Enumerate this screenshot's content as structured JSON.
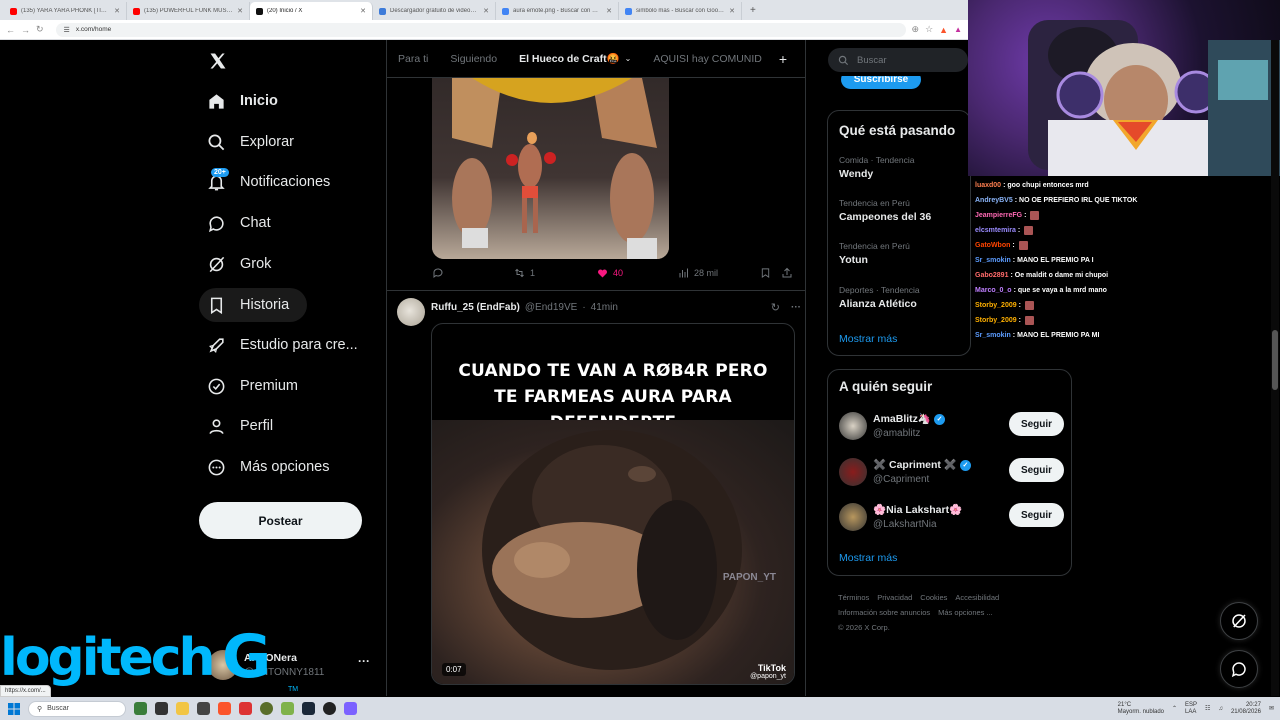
{
  "browser": {
    "tabs": [
      {
        "title": "(135) YARA YARA PHONK [TIKTOK VI...",
        "color": "#ff0000",
        "active": false
      },
      {
        "title": "(135) POWERFUL FUNK MUSIC → T...",
        "color": "#ff0000",
        "active": false
      },
      {
        "title": "(20) Inicio / X",
        "color": "#111111",
        "active": true
      },
      {
        "title": "Descargador gratuito de videos de T...",
        "color": "#3d7bd9",
        "active": false
      },
      {
        "title": "aura emote.png - Buscar con Google",
        "color": "#4285f4",
        "active": false
      },
      {
        "title": "simbolo mas - Buscar con Google",
        "color": "#4285f4",
        "active": false
      }
    ],
    "new_tab_glyph": "+",
    "url": "x.com/home",
    "status_url": "https://x.com/..."
  },
  "sidebar": {
    "logo": "X",
    "items": [
      {
        "label": "Inicio",
        "icon": "home-icon"
      },
      {
        "label": "Explorar",
        "icon": "search-icon"
      },
      {
        "label": "Notificaciones",
        "icon": "bell-icon",
        "badge": "20+"
      },
      {
        "label": "Chat",
        "icon": "chat-bubble-icon"
      },
      {
        "label": "Grok",
        "icon": "grok-icon"
      },
      {
        "label": "Historia",
        "icon": "bookmark-icon"
      },
      {
        "label": "Estudio para cre...",
        "icon": "rocket-icon"
      },
      {
        "label": "Premium",
        "icon": "verified-badge-icon"
      },
      {
        "label": "Perfil",
        "icon": "person-icon"
      },
      {
        "label": "Más opciones",
        "icon": "more-circle-icon"
      }
    ],
    "post_label": "Postear",
    "account": {
      "name": "ANTONera",
      "handle": "@ANTONNY1811",
      "more": "···"
    }
  },
  "overlay": {
    "logitech": "logitech",
    "g": "G",
    "tm": "TM"
  },
  "feed": {
    "tabs": [
      {
        "label": "Para ti",
        "active": false
      },
      {
        "label": "Siguiendo",
        "active": false
      },
      {
        "label": "El Hueco de Craft🤬",
        "active": true
      },
      {
        "label": "AQUISI hay COMUNID",
        "active": false
      }
    ],
    "add_tab": "+",
    "post1": {
      "replies": "",
      "reposts": "1",
      "likes": "40",
      "views": "28 mil",
      "like_color": "#f91880"
    },
    "post2": {
      "author": "Ruffu_25 (EndFab)",
      "handle": "@End19VE",
      "time": "41min",
      "meme_line1": "CUANDO TE VAN A RØB4R PERO",
      "meme_line2": "TE FARMEAS AURA PARA DEFENDERTE",
      "watermark": "PAPON_YT",
      "duration": "0:07",
      "tiktok": "TikTok",
      "tiktok_user": "@papon_yt"
    }
  },
  "right": {
    "search_placeholder": "Buscar",
    "subscribe": "Suscribirse",
    "trends_title": "Qué está pasando",
    "trends": [
      {
        "meta": "Comida · Tendencia",
        "name": "Wendy"
      },
      {
        "meta": "Tendencia en Perú",
        "name": "Campeones del 36"
      },
      {
        "meta": "Tendencia en Perú",
        "name": "Yotun"
      },
      {
        "meta": "Deportes · Tendencia",
        "name": "Alianza Atlético"
      }
    ],
    "show_more": "Mostrar más",
    "follow_title": "A quién seguir",
    "who": [
      {
        "name": "AmaBlitz🦄",
        "handle": "@amablitz",
        "verified": true,
        "color": "#d9d2c5"
      },
      {
        "name": "✖️ Capriment ✖️",
        "handle": "@Capriment",
        "verified": true,
        "color": "#8a1c1c"
      },
      {
        "name": "🌸Nia Lakshart🌸",
        "handle": "@LakshartNia",
        "verified": false,
        "color": "#b8975e"
      }
    ],
    "follow_label": "Seguir",
    "footer": [
      "Términos",
      "Privacidad",
      "Cookies",
      "Accesibilidad",
      "Información sobre anuncios",
      "Más opciones ...",
      "© 2026 X Corp."
    ]
  },
  "chat": [
    {
      "user": "luaxd00",
      "color": "#ff7f50",
      "text": ": goo chupi entonces mrd"
    },
    {
      "user": "AndreyBV5",
      "color": "#8ab4f8",
      "text": ": NO OE PREFIERO IRL QUE TIKTOK"
    },
    {
      "user": "JeampierreFG",
      "color": "#ff69b4",
      "text": ":"
    },
    {
      "user": "elcsmtemira",
      "color": "#9b8cff",
      "text": ":"
    },
    {
      "user": "GatoWbon",
      "color": "#ff4500",
      "text": ":"
    },
    {
      "user": "Sr_smokin",
      "color": "#5c9cff",
      "text": ": MANO EL PREMIO PA I"
    },
    {
      "user": "Gabo2891",
      "color": "#ff6b6b",
      "text": ": Oe maldit o dame mi chupoi"
    },
    {
      "user": "Marco_0_o",
      "color": "#bf7fff",
      "text": ": que se vaya a la mrd mano"
    },
    {
      "user": "Storby_2009",
      "color": "#ffb000",
      "text": ":"
    },
    {
      "user": "Storby_2009",
      "color": "#ffb000",
      "text": ":"
    },
    {
      "user": "Sr_smokin",
      "color": "#5c9cff",
      "text": ": MANO EL PREMIO PA MI"
    }
  ],
  "taskbar": {
    "search": "Buscar",
    "weather_temp": "21°C",
    "weather_desc": "Mayorm. nublado",
    "lang": "ESP",
    "lang2": "LAA",
    "time": "20:27",
    "date": "21/08/2026"
  }
}
